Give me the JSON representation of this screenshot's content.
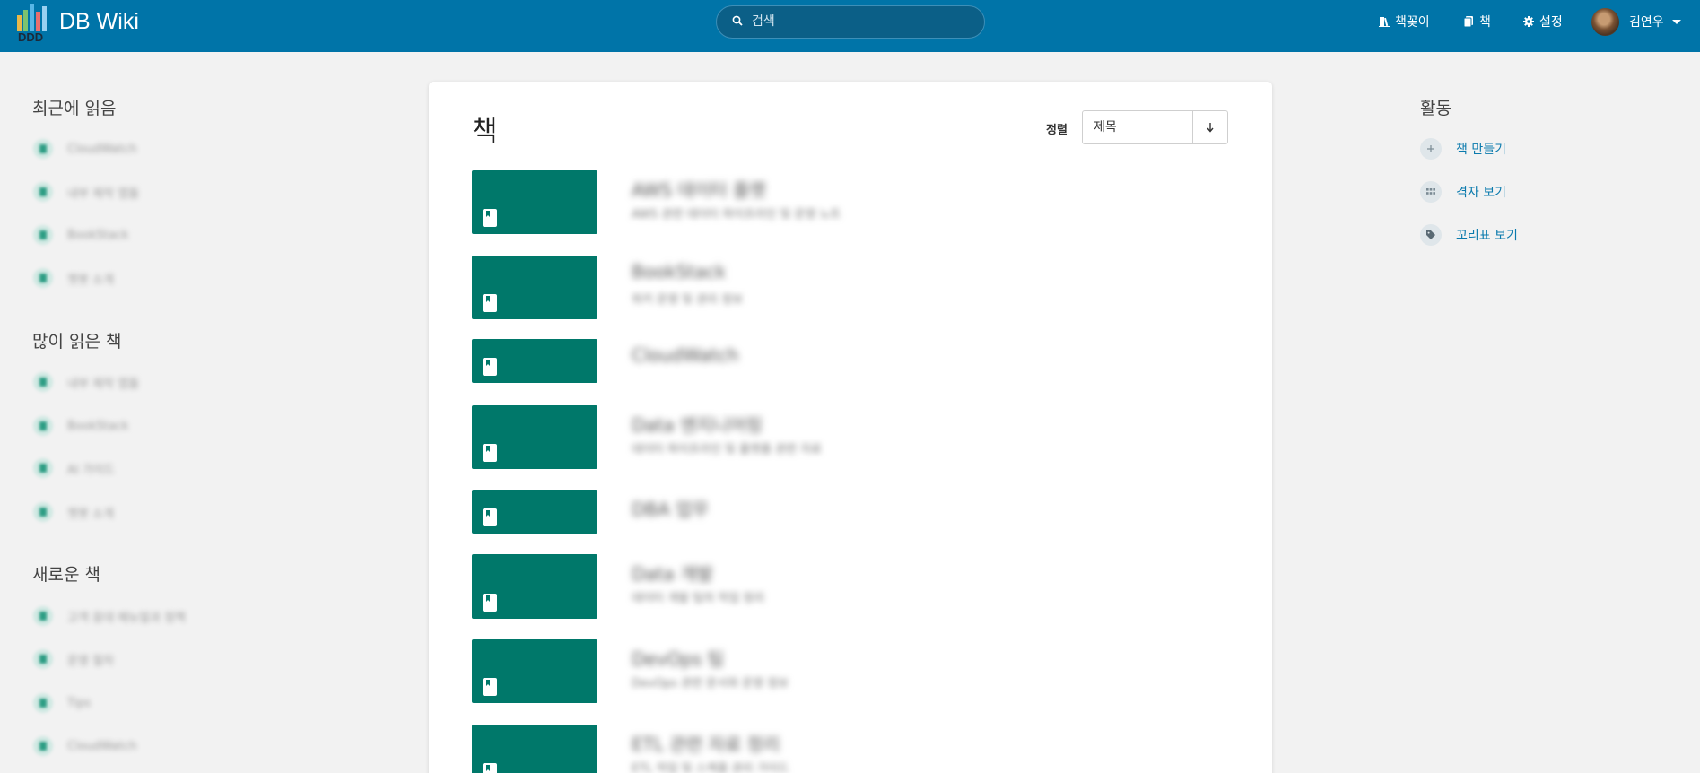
{
  "app": {
    "name": "DB Wiki"
  },
  "search": {
    "placeholder": "검색"
  },
  "nav": {
    "shelves": "책꽂이",
    "books": "책",
    "settings": "설정",
    "user": "김연우"
  },
  "sidebar": {
    "recent": {
      "heading": "최근에 읽음",
      "items": [
        "CloudWatch",
        "내부 제작 앱들",
        "BookStack",
        "챗봇 소개"
      ]
    },
    "popular": {
      "heading": "많이 읽은 책",
      "items": [
        "내부 제작 앱들",
        "BookStack",
        "AI 가이드",
        "챗봇 소개"
      ]
    },
    "new": {
      "heading": "새로운 책",
      "items": [
        "고객 응대 매뉴얼과 정책",
        "운영 절차",
        "Tips",
        "CloudWatch"
      ]
    }
  },
  "main": {
    "title": "책",
    "sort_label": "정렬",
    "sort_value": "제목",
    "books": [
      {
        "title": "AWS 데이터 플랫",
        "desc": "AWS 관련 데이터 파이프라인 및 운영 노트"
      },
      {
        "title": "BookStack",
        "desc": "위키 운영 및 관리 정보"
      },
      {
        "title": "CloudWatch",
        "desc": ""
      },
      {
        "title": "Data 엔지니어링",
        "desc": "데이터 파이프라인 및 플랫폼 관련 자료"
      },
      {
        "title": "DBA 업무",
        "desc": ""
      },
      {
        "title": "Data 개발",
        "desc": "데이터 개발 팀의 작업 정리"
      },
      {
        "title": "DevOps 팀",
        "desc": "DevOps 관련 문서와 운영 정보"
      },
      {
        "title": "ETL 관련 자료 정리",
        "desc": "ETL 작업 및 스케줄 관리 가이드"
      }
    ]
  },
  "activity": {
    "heading": "활동",
    "create_book": "책 만들기",
    "grid_view": "격자 보기",
    "tags_view": "꼬리표 보기"
  },
  "colors": {
    "header": "#0074a8",
    "cover": "#00786a",
    "link": "#0a7aad"
  }
}
